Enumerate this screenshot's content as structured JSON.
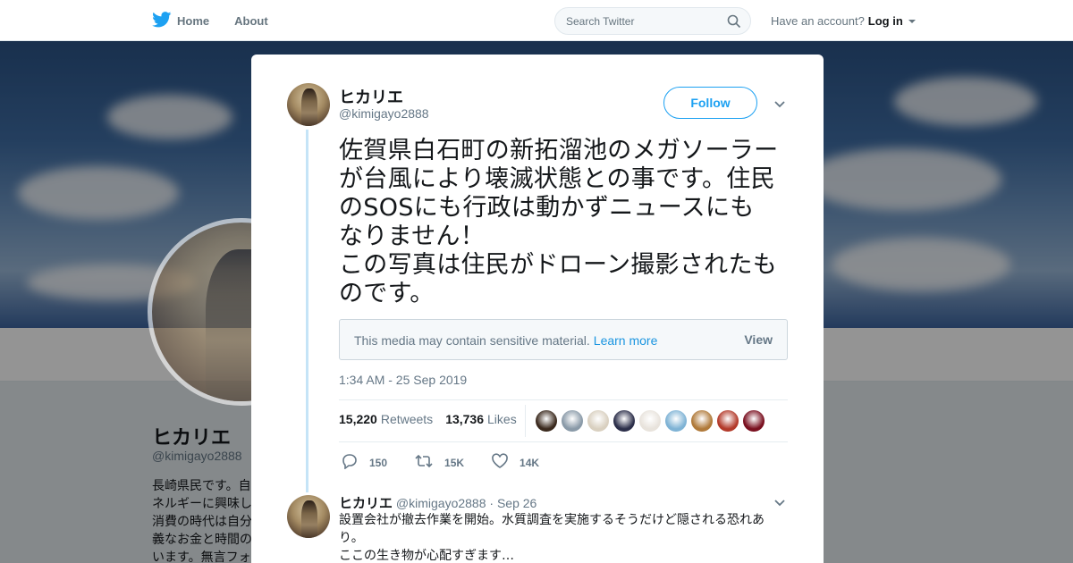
{
  "nav": {
    "home_label": "Home",
    "about_label": "About",
    "search_placeholder": "Search Twitter",
    "account_prompt": "Have an account?",
    "login_label": "Log in",
    "brand_color": "#1da1f2"
  },
  "profile": {
    "name": "ヒカリエ",
    "handle": "@kimigayo2888",
    "bio_lines": [
      "長崎県民です。自",
      "ネルギーに興味し",
      "消費の時代は自分",
      "義なお金と時間の",
      "います。無言フォ"
    ]
  },
  "tweet": {
    "author_name": "ヒカリエ",
    "author_handle": "@kimigayo2888",
    "follow_label": "Follow",
    "text": "佐賀県白石町の新拓溜池のメガソーラー\nが台風により壊滅状態との事です。住民\nのSOSにも行政は動かずニュースにも\nなりません！\nこの写真は住民がドローン撮影されたも\nのです。",
    "sensitive_msg": "This media may contain sensitive material.",
    "learn_more": "Learn more",
    "view_label": "View",
    "timestamp": "1:34 AM - 25 Sep 2019",
    "retweets_count": "15,220",
    "retweets_label": "Retweets",
    "likes_count": "13,736",
    "likes_label": "Likes",
    "liker_colors": [
      "#3b2a1e",
      "#8a9aa8",
      "#d9d0c0",
      "#2c2f4a",
      "#e8e3dc",
      "#7fb3d5",
      "#b07a3a",
      "#b33a2a",
      "#7a1020"
    ],
    "reply_count": "150",
    "retweet_short": "15K",
    "like_short": "14K"
  },
  "reply": {
    "author_name": "ヒカリエ",
    "author_handle": "@kimigayo2888",
    "date": "· Sep 26",
    "text": "設置会社が撤去作業を開始。水質調査を実施するそうだけど隠される恐れあ\nり。\nここの生き物が心配すぎます…"
  }
}
